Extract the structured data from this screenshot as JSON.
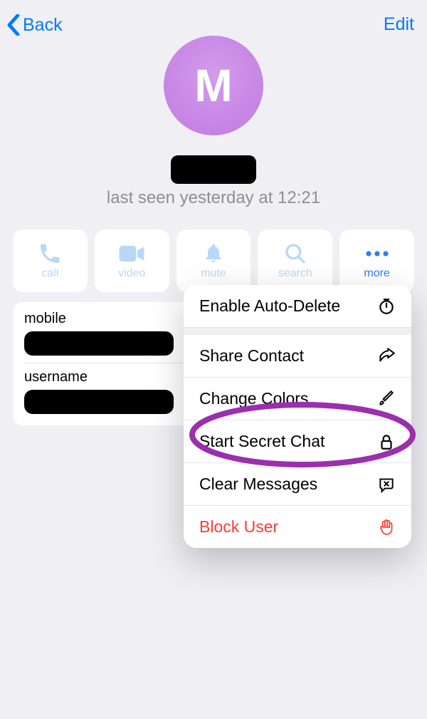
{
  "header": {
    "back": "Back",
    "edit": "Edit"
  },
  "avatar": {
    "initial": "M"
  },
  "status": "last seen yesterday at 12:21",
  "actions": {
    "call": "call",
    "video": "video",
    "mute": "mute",
    "search": "search",
    "more": "more"
  },
  "info": {
    "mobile_label": "mobile",
    "username_label": "username"
  },
  "menu": {
    "auto_delete": "Enable Auto-Delete",
    "share_contact": "Share Contact",
    "change_colors": "Change Colors",
    "secret_chat": "Start Secret Chat",
    "clear_messages": "Clear Messages",
    "block_user": "Block User"
  }
}
